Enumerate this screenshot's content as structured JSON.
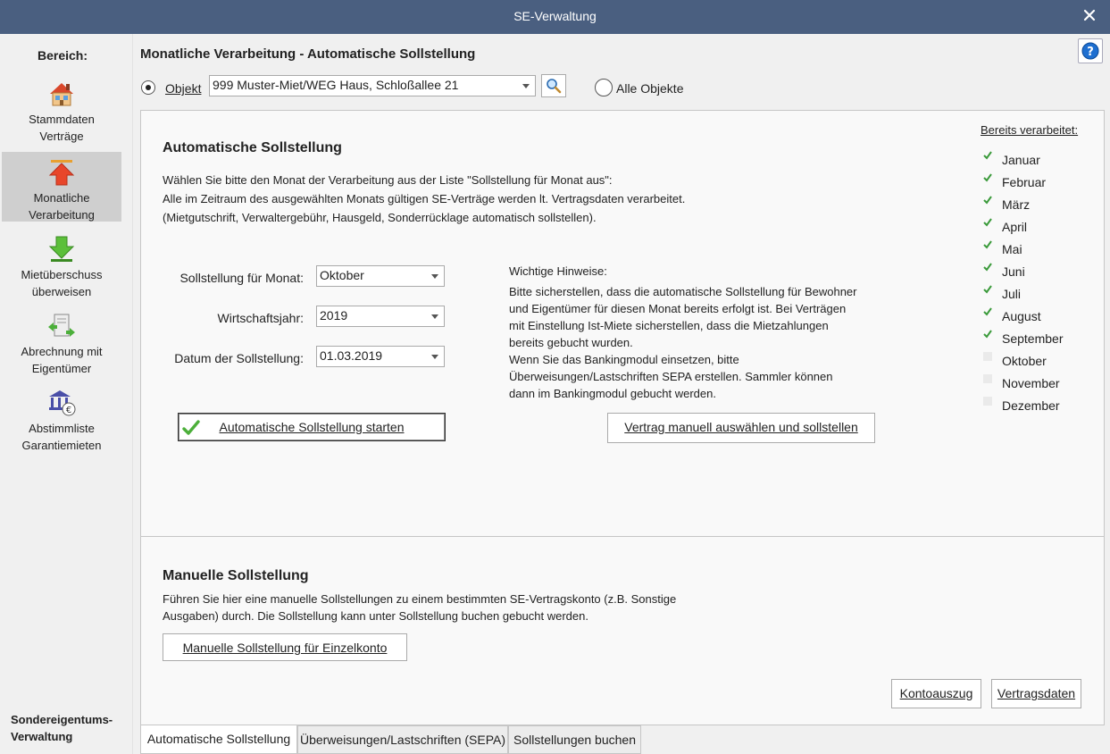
{
  "window": {
    "title": "SE-Verwaltung"
  },
  "sidebar": {
    "heading": "Bereich:",
    "items": [
      {
        "label": "Stammdaten\nVerträge",
        "icon": "house-icon"
      },
      {
        "label": "Monatliche\nVerarbeitung",
        "icon": "arrow-up-icon"
      },
      {
        "label": "Mietüberschuss\nüberweisen",
        "icon": "arrow-down-icon"
      },
      {
        "label": "Abrechnung mit\nEigentümer",
        "icon": "document-transfer-icon"
      },
      {
        "label": "Abstimmliste\nGarantiemieten",
        "icon": "bank-euro-icon"
      }
    ],
    "footer": "Sondereigentums-\nVerwaltung"
  },
  "header": {
    "title": "Monatliche Verarbeitung - Automatische Sollstellung",
    "objekt_radio": "Objekt",
    "objekt_value": "999 Muster-Miet/WEG Haus, Schloßallee 21",
    "alle_objekte_radio": "Alle Objekte"
  },
  "auto": {
    "title": "Automatische Sollstellung",
    "desc1": "Wählen Sie bitte den Monat der Verarbeitung aus der Liste \"Sollstellung für Monat aus\":",
    "desc2": "Alle im Zeitraum des ausgewählten Monats gültigen SE-Verträge werden lt. Vertragsdaten verarbeitet.",
    "desc3": "(Mietgutschrift, Verwaltergebühr, Hausgeld, Sonderrücklage automatisch sollstellen).",
    "month_label": "Sollstellung für Monat:",
    "month_value": "Oktober",
    "year_label": "Wirtschaftsjahr:",
    "year_value": "2019",
    "date_label": "Datum der Sollstellung:",
    "date_value": "01.03.2019",
    "start_button": "Automatische Sollstellung starten",
    "hints_title": "Wichtige Hinweise:",
    "hints": [
      "Bitte sicherstellen, dass die automatische Sollstellung für Bewohner",
      "und Eigentümer für diesen Monat bereits erfolgt ist. Bei Verträgen",
      "mit Einstellung Ist-Miete  sicherstellen, dass die Mietzahlungen",
      "bereits gebucht wurden.",
      "Wenn Sie das Bankingmodul einsetzen, bitte",
      "Überweisungen/Lastschriften SEPA erstellen. Sammler können",
      "dann im Bankingmodul gebucht werden."
    ],
    "manual_contract_button": "Vertrag manuell auswählen und sollstellen"
  },
  "processed": {
    "title": "Bereits verarbeitet:",
    "months": [
      {
        "name": "Januar",
        "done": true
      },
      {
        "name": "Februar",
        "done": true
      },
      {
        "name": "März",
        "done": true
      },
      {
        "name": "April",
        "done": true
      },
      {
        "name": "Mai",
        "done": true
      },
      {
        "name": "Juni",
        "done": true
      },
      {
        "name": "Juli",
        "done": true
      },
      {
        "name": "August",
        "done": true
      },
      {
        "name": "September",
        "done": true
      },
      {
        "name": "Oktober",
        "done": false
      },
      {
        "name": "November",
        "done": false
      },
      {
        "name": "Dezember",
        "done": false
      }
    ],
    "check_color": "#3a9a3a"
  },
  "manual": {
    "title": "Manuelle Sollstellung",
    "desc1": "Führen Sie hier eine manuelle Sollstellungen zu einem bestimmten SE-Vertragskonto (z.B. Sonstige",
    "desc2": "Ausgaben) durch. Die Sollstellung kann unter Sollstellung buchen gebucht werden.",
    "single_account_button": "Manuelle Sollstellung für Einzelkonto"
  },
  "footer_buttons": {
    "kontoauszug": "Kontoauszug",
    "vertragsdaten": "Vertragsdaten"
  },
  "tabs": [
    {
      "label": "Automatische Sollstellung",
      "active": true
    },
    {
      "label": "Überweisungen/Lastschriften (SEPA)",
      "active": false
    },
    {
      "label": "Sollstellungen buchen",
      "active": false
    }
  ]
}
